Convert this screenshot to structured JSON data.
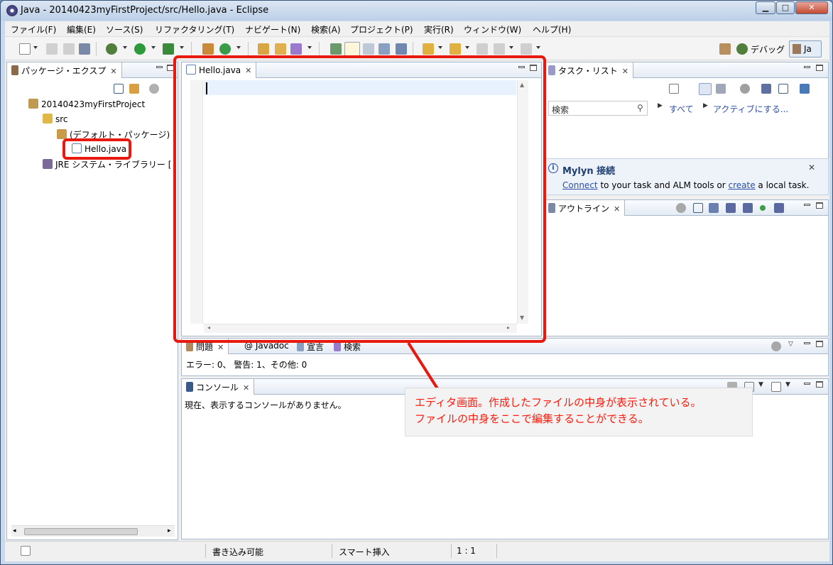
{
  "window": {
    "title": "Java - 20140423myFirstProject/src/Hello.java - Eclipse",
    "min_glyph": "▁",
    "max_glyph": "□",
    "close_glyph": "✕"
  },
  "menu": {
    "items": [
      "ファイル(F)",
      "編集(E)",
      "ソース(S)",
      "リファクタリング(T)",
      "ナビゲート(N)",
      "検索(A)",
      "プロジェクト(P)",
      "実行(R)",
      "ウィンドウ(W)",
      "ヘルプ(H)"
    ]
  },
  "perspectives": {
    "debug": "デバッグ",
    "java": "Ja"
  },
  "package_explorer": {
    "tab_label": "パッケージ・エクスプ",
    "close_glyph": "✕",
    "tree": {
      "project": "20140423myFirstProject",
      "src": "src",
      "package": "(デフォルト・パッケージ)",
      "file": "Hello.java",
      "jre": "JRE システム・ライブラリー ["
    }
  },
  "editor": {
    "tab_label": "Hello.java",
    "close_glyph": "✕"
  },
  "task_list": {
    "tab_label": "タスク・リスト",
    "close_glyph": "✕",
    "search_placeholder": "検索",
    "all_label": "すべて",
    "activate_label": "アクティブにする..."
  },
  "mylyn": {
    "title": "Mylyn 接続",
    "connect_link": "Connect",
    "text_mid": " to your task and ALM tools or ",
    "create_link": "create",
    "text_end": " a local task."
  },
  "outline": {
    "tab_label": "アウトライン",
    "close_glyph": "✕"
  },
  "problems": {
    "tabs": [
      "問題",
      "Javadoc",
      "宣言",
      "検索"
    ],
    "javadoc_prefix": "@",
    "close_glyph": "✕",
    "summary": "エラー: 0、 警告: 1、その他: 0"
  },
  "console": {
    "tab_label": "コンソール",
    "close_glyph": "✕",
    "message": "現在、表示するコンソールがありません。"
  },
  "callout": {
    "line1": "エディタ画面。作成したファイルの中身が表示されている。",
    "line2": "ファイルの中身をここで編集することができる。"
  },
  "statusbar": {
    "writable": "書き込み可能",
    "insert_mode": "スマート挿入",
    "position": "1 : 1"
  },
  "colors": {
    "highlight_red": "#e8190e",
    "callout_text": "#ff1a0a",
    "link_blue": "#2b4fa8"
  }
}
